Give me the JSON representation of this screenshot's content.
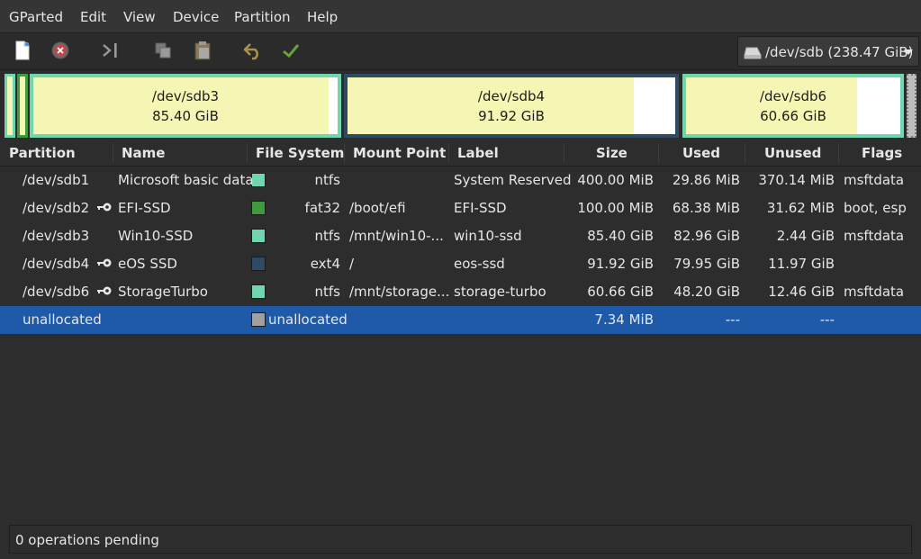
{
  "menu": [
    "GParted",
    "Edit",
    "View",
    "Device",
    "Partition",
    "Help"
  ],
  "device": {
    "label": "/dev/sdb (238.47 GiB)"
  },
  "graphic": {
    "sdb3": {
      "name": "/dev/sdb3",
      "size": "85.40 GiB"
    },
    "sdb4": {
      "name": "/dev/sdb4",
      "size": "91.92 GiB"
    },
    "sdb6": {
      "name": "/dev/sdb6",
      "size": "60.66 GiB"
    }
  },
  "table": {
    "headers": [
      "Partition",
      "Name",
      "File System",
      "Mount Point",
      "Label",
      "Size",
      "Used",
      "Unused",
      "Flags"
    ],
    "rows": [
      {
        "partition": "/dev/sdb1",
        "key": false,
        "name": "Microsoft basic data",
        "fs_color": "#6fd6b0",
        "fs": "ntfs",
        "mount": "",
        "label": "System Reserved",
        "size": "400.00 MiB",
        "used": "29.86 MiB",
        "unused": "370.14 MiB",
        "flags": "msftdata"
      },
      {
        "partition": "/dev/sdb2",
        "key": true,
        "name": "EFI-SSD",
        "fs_color": "#3f9a3d",
        "fs": "fat32",
        "mount": "/boot/efi",
        "label": "EFI-SSD",
        "size": "100.00 MiB",
        "used": "68.38 MiB",
        "unused": "31.62 MiB",
        "flags": "boot, esp"
      },
      {
        "partition": "/dev/sdb3",
        "key": false,
        "name": "Win10-SSD",
        "fs_color": "#6fd6b0",
        "fs": "ntfs",
        "mount": "/mnt/win10-...",
        "label": "win10-ssd",
        "size": "85.40 GiB",
        "used": "82.96 GiB",
        "unused": "2.44 GiB",
        "flags": "msftdata"
      },
      {
        "partition": "/dev/sdb4",
        "key": true,
        "name": "eOS SSD",
        "fs_color": "#2f4a63",
        "fs": "ext4",
        "mount": "/",
        "label": "eos-ssd",
        "size": "91.92 GiB",
        "used": "79.95 GiB",
        "unused": "11.97 GiB",
        "flags": ""
      },
      {
        "partition": "/dev/sdb6",
        "key": true,
        "name": "StorageTurbo",
        "fs_color": "#6fd6b0",
        "fs": "ntfs",
        "mount": "/mnt/storage...",
        "label": "storage-turbo",
        "size": "60.66 GiB",
        "used": "48.20 GiB",
        "unused": "12.46 GiB",
        "flags": "msftdata"
      },
      {
        "partition": "unallocated",
        "key": false,
        "name": "",
        "fs_color": "#a0a0a0",
        "fs": "unallocated",
        "mount": "",
        "label": "",
        "size": "7.34 MiB",
        "used": "---",
        "unused": "---",
        "flags": "",
        "selected": true
      }
    ]
  },
  "status": "0 operations pending",
  "colors": {
    "ntfs": "#6fd6b0",
    "fat32": "#3f9a3d",
    "ext4": "#2f4a63",
    "used": "#f6f6b4",
    "selection": "#1e5aa8"
  }
}
